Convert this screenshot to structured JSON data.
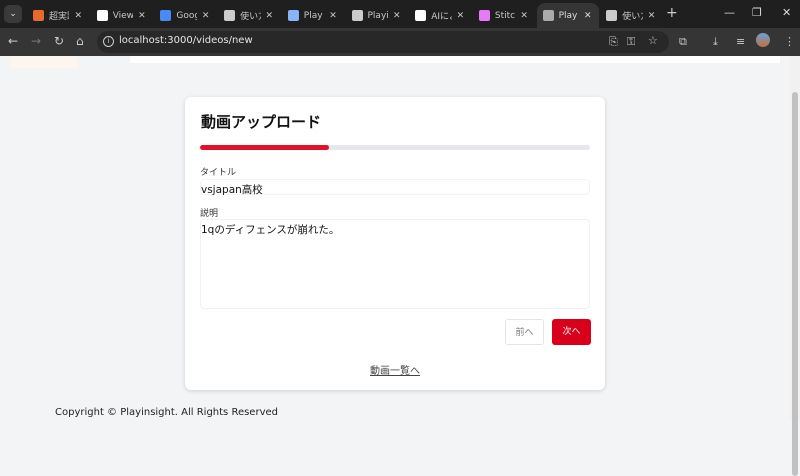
{
  "browser": {
    "tabs": [
      {
        "title": "超実践",
        "icon": "r-logo-icon",
        "color": "#e8692c"
      },
      {
        "title": "View",
        "icon": "github-icon",
        "color": "#ffffff"
      },
      {
        "title": "Goog",
        "icon": "google-translate-icon",
        "color": "#4a8af4"
      },
      {
        "title": "使い方",
        "icon": "openai-icon",
        "color": "#cccccc"
      },
      {
        "title": "Play i",
        "icon": "docker-icon",
        "color": "#8ab4f8"
      },
      {
        "title": "Playin",
        "icon": "git-icon",
        "color": "#cccccc"
      },
      {
        "title": "AIによ",
        "icon": "notion-n-icon",
        "color": "#ffffff"
      },
      {
        "title": "Stitch",
        "icon": "stitch-icon",
        "color": "#e879f9"
      },
      {
        "title": "Play i",
        "icon": "globe-icon",
        "color": "#aaaaaa",
        "active": true
      },
      {
        "title": "使い方",
        "icon": "notion-icon",
        "color": "#cccccc"
      }
    ],
    "url": "localhost:3000/videos/new"
  },
  "form": {
    "title": "動画アップロード",
    "progress_percent": 33,
    "title_label": "タイトル",
    "title_value": "vsjapan高校",
    "description_label": "説明",
    "description_value": "1qのディフェンスが崩れた。",
    "prev_label": "前へ",
    "next_label": "次へ",
    "list_link": "動画一覧へ"
  },
  "colors": {
    "accent": "#d9001b",
    "progress": "#e0112b"
  },
  "footer": {
    "copyright": "Copyright © Playinsight. All Rights Reserved"
  }
}
